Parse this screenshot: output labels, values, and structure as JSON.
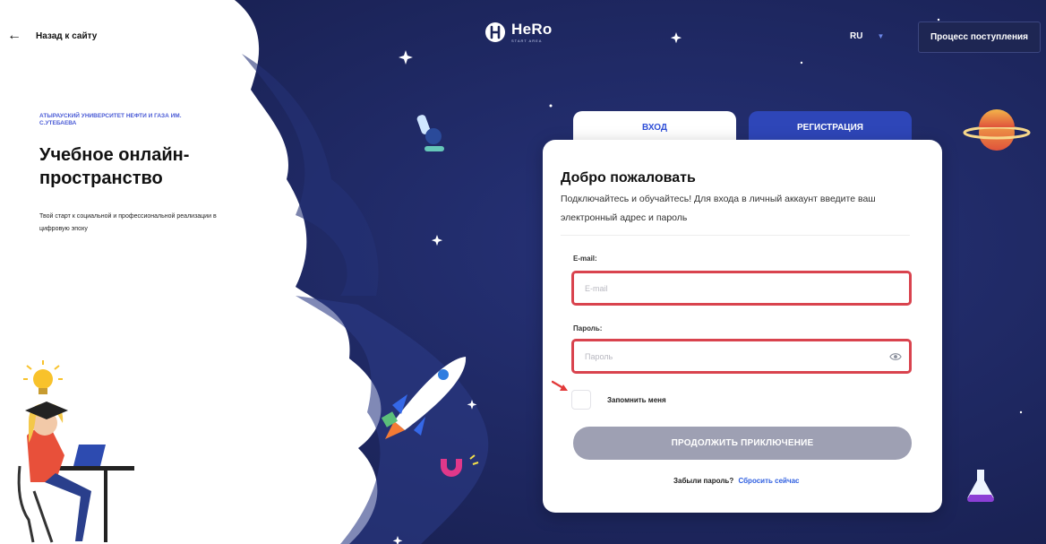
{
  "nav": {
    "back_label": "Назад к сайту",
    "logo_name": "HeRo",
    "logo_sub": "START AREA",
    "language": "RU",
    "admission_label": "Процесс поступления"
  },
  "hero": {
    "university": "АТЫРАУСКИЙ УНИВЕРСИТЕТ НЕФТИ И ГАЗА ИМ. С.УТЕБАЕВА",
    "title": "Учебное онлайн-пространство",
    "subtitle": "Твой старт к социальной и профессиональной реализации в цифровую эпоху"
  },
  "tabs": {
    "login": "ВХОД",
    "register": "РЕГИСТРАЦИЯ"
  },
  "form": {
    "title": "Добро пожаловать",
    "description": "Подключайтесь и обучайтесь! Для входа в личный аккаунт введите ваш электронный адрес и пароль",
    "email_label": "E-mail:",
    "email_placeholder": "E-mail",
    "email_value": "",
    "password_label": "Пароль:",
    "password_placeholder": "Пароль",
    "password_value": "",
    "remember_label": "Запомнить меня",
    "submit_label": "ПРОДОЛЖИТЬ ПРИКЛЮЧЕНИЕ",
    "forgot_text": "Забыли пароль?",
    "reset_link": "Сбросить сейчас"
  },
  "colors": {
    "space_bg": "#1b2456",
    "accent_blue": "#2f4fd8",
    "tab_inactive": "#2e46b8",
    "error_border": "#d9434e",
    "button_disabled": "#9ea0b3"
  },
  "icons": [
    "back-arrow-icon",
    "hero-logo-icon",
    "chevron-down-icon",
    "eye-icon",
    "star-icon",
    "planet-icon",
    "microscope-icon",
    "rocket-icon",
    "magnet-icon",
    "flask-icon",
    "lightbulb-icon",
    "student-illustration",
    "red-arrow-icon"
  ]
}
